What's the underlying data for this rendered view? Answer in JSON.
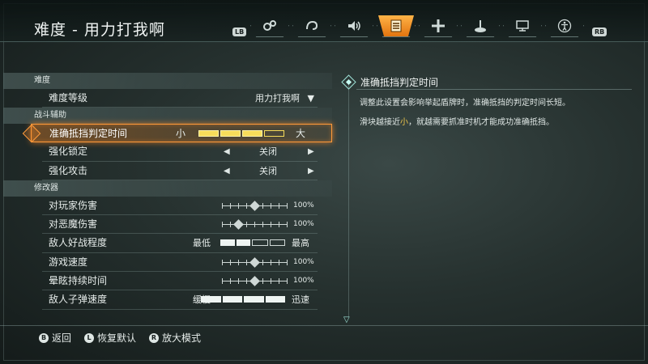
{
  "header": {
    "title": "难度 - 用力打我啊",
    "lb": "LB",
    "rb": "RB",
    "tabs": [
      {
        "icon": "gears-icon",
        "active": false
      },
      {
        "icon": "swirl-icon",
        "active": false
      },
      {
        "icon": "speaker-icon",
        "active": false
      },
      {
        "icon": "list-icon",
        "active": true
      },
      {
        "icon": "crosshair-icon",
        "active": false
      },
      {
        "icon": "joystick-icon",
        "active": false
      },
      {
        "icon": "monitor-icon",
        "active": false
      },
      {
        "icon": "accessibility-icon",
        "active": false
      }
    ]
  },
  "sections": {
    "difficulty": {
      "title": "难度",
      "level_label": "难度等级",
      "level_value": "用力打我啊"
    },
    "combat": {
      "title": "战斗辅助",
      "parry_label": "准确抵挡判定时间",
      "parry_min": "小",
      "parry_max": "大",
      "parry_level": 0.75,
      "lock_label": "强化锁定",
      "lock_value": "关闭",
      "attack_label": "强化攻击",
      "attack_value": "关闭"
    },
    "modifiers": {
      "title": "修改器",
      "player_dmg_label": "对玩家伤害",
      "player_dmg_value": "100%",
      "player_dmg_level": 0.5,
      "demon_dmg_label": "对恶魔伤害",
      "demon_dmg_value": "100%",
      "demon_dmg_level": 0.25,
      "aggro_label": "敌人好战程度",
      "aggro_min": "最低",
      "aggro_max": "最高",
      "aggro_level": 0.5,
      "speed_label": "游戏速度",
      "speed_value": "100%",
      "speed_level": 0.5,
      "stun_label": "晕眩持续时间",
      "stun_value": "100%",
      "stun_level": 0.5,
      "bullet_label": "敌人子弹速度",
      "bullet_min": "缓慢",
      "bullet_max": "迅速",
      "bullet_level": 1.0
    }
  },
  "description": {
    "title": "准确抵挡判定时间",
    "para1": "调整此设置会影响举起盾牌时，准确抵挡的判定时间长短。",
    "para2_pre": "滑块越接近",
    "para2_hl": "小",
    "para2_post": "，就越需要抓准时机才能成功准确抵挡。"
  },
  "footer": {
    "back": {
      "glyph": "B",
      "label": "返回"
    },
    "reset": {
      "glyph": "L",
      "label": "恢复默认"
    },
    "zoom": {
      "glyph": "R",
      "label": "放大模式"
    }
  }
}
